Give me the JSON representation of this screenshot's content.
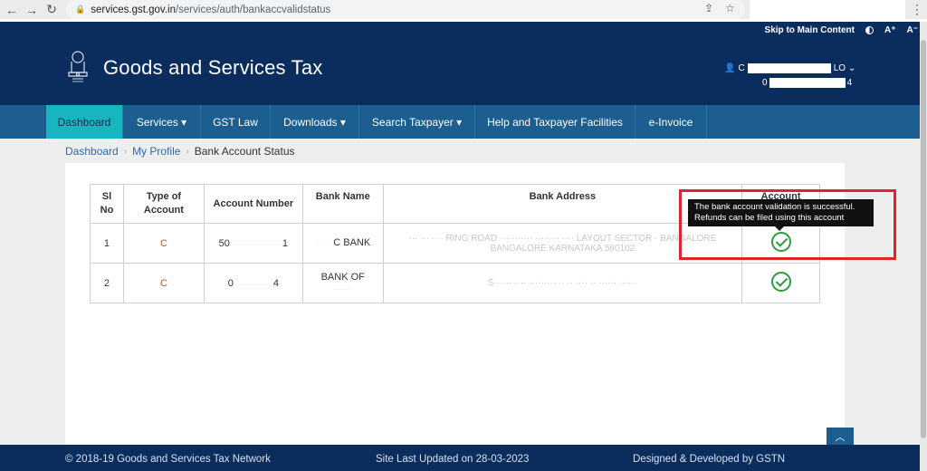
{
  "browser": {
    "url_host": "services.gst.gov.in",
    "url_path": "/services/auth/bankaccvalidstatus",
    "back_icon": "back-arrow-icon",
    "forward_icon": "forward-arrow-icon",
    "reload_icon": "reload-icon"
  },
  "header": {
    "skip_link": "Skip to Main Content",
    "font_increase": "A⁺",
    "font_decrease": "A⁻",
    "site_title": "Goods and Services Tax",
    "user_name_visible": "C",
    "user_name_suffix": "LO",
    "user_id_prefix": "0",
    "user_id_suffix": "4"
  },
  "nav": {
    "items": [
      {
        "label": "Dashboard"
      },
      {
        "label": "Services ▾"
      },
      {
        "label": "GST Law"
      },
      {
        "label": "Downloads ▾"
      },
      {
        "label": "Search Taxpayer ▾"
      },
      {
        "label": "Help and Taxpayer Facilities"
      },
      {
        "label": "e-Invoice"
      }
    ]
  },
  "breadcrumb": {
    "dashboard": "Dashboard",
    "profile": "My Profile",
    "current": "Bank Account Status"
  },
  "table": {
    "headers": {
      "sl_no": "Sl No",
      "type": "Type of Account",
      "number": "Account Number",
      "bank": "Bank Name",
      "address": "Bank Address",
      "validation": "Account"
    },
    "rows": [
      {
        "sl": "1",
        "type": "C",
        "acct_start": "50",
        "acct_hidden": "·····························",
        "acct_end": "1",
        "bank_hidden": "··········",
        "bank_visible": "C BANK",
        "address": "··· ··· ·· ·  RING ROAD ··········· ········ ···· LAYOUT SECTOR · BANGALORE BANGALORE KARNATAKA 560102"
      },
      {
        "sl": "2",
        "type": "C",
        "acct_start": "0",
        "acct_hidden": "······················",
        "acct_end": "4",
        "bank_visible": "BANK OF",
        "bank_hidden": "··········",
        "address": "S······ ···· ········· ·· ·· ···· ·· ······ ······"
      }
    ]
  },
  "tooltip": {
    "line1": "The bank account validation is successful.",
    "line2": "Refunds can be filed using this account"
  },
  "footer": {
    "copyright": "© 2018-19 Goods and Services Tax Network",
    "updated": "Site Last Updated on 28-03-2023",
    "designed": "Designed & Developed by GSTN"
  },
  "colors": {
    "header_bg": "#0b2d5e",
    "nav_bg": "#1b5e8f",
    "nav_active": "#17b5c0",
    "success_green": "#2e9b3e",
    "highlight_red": "#e0242c"
  }
}
